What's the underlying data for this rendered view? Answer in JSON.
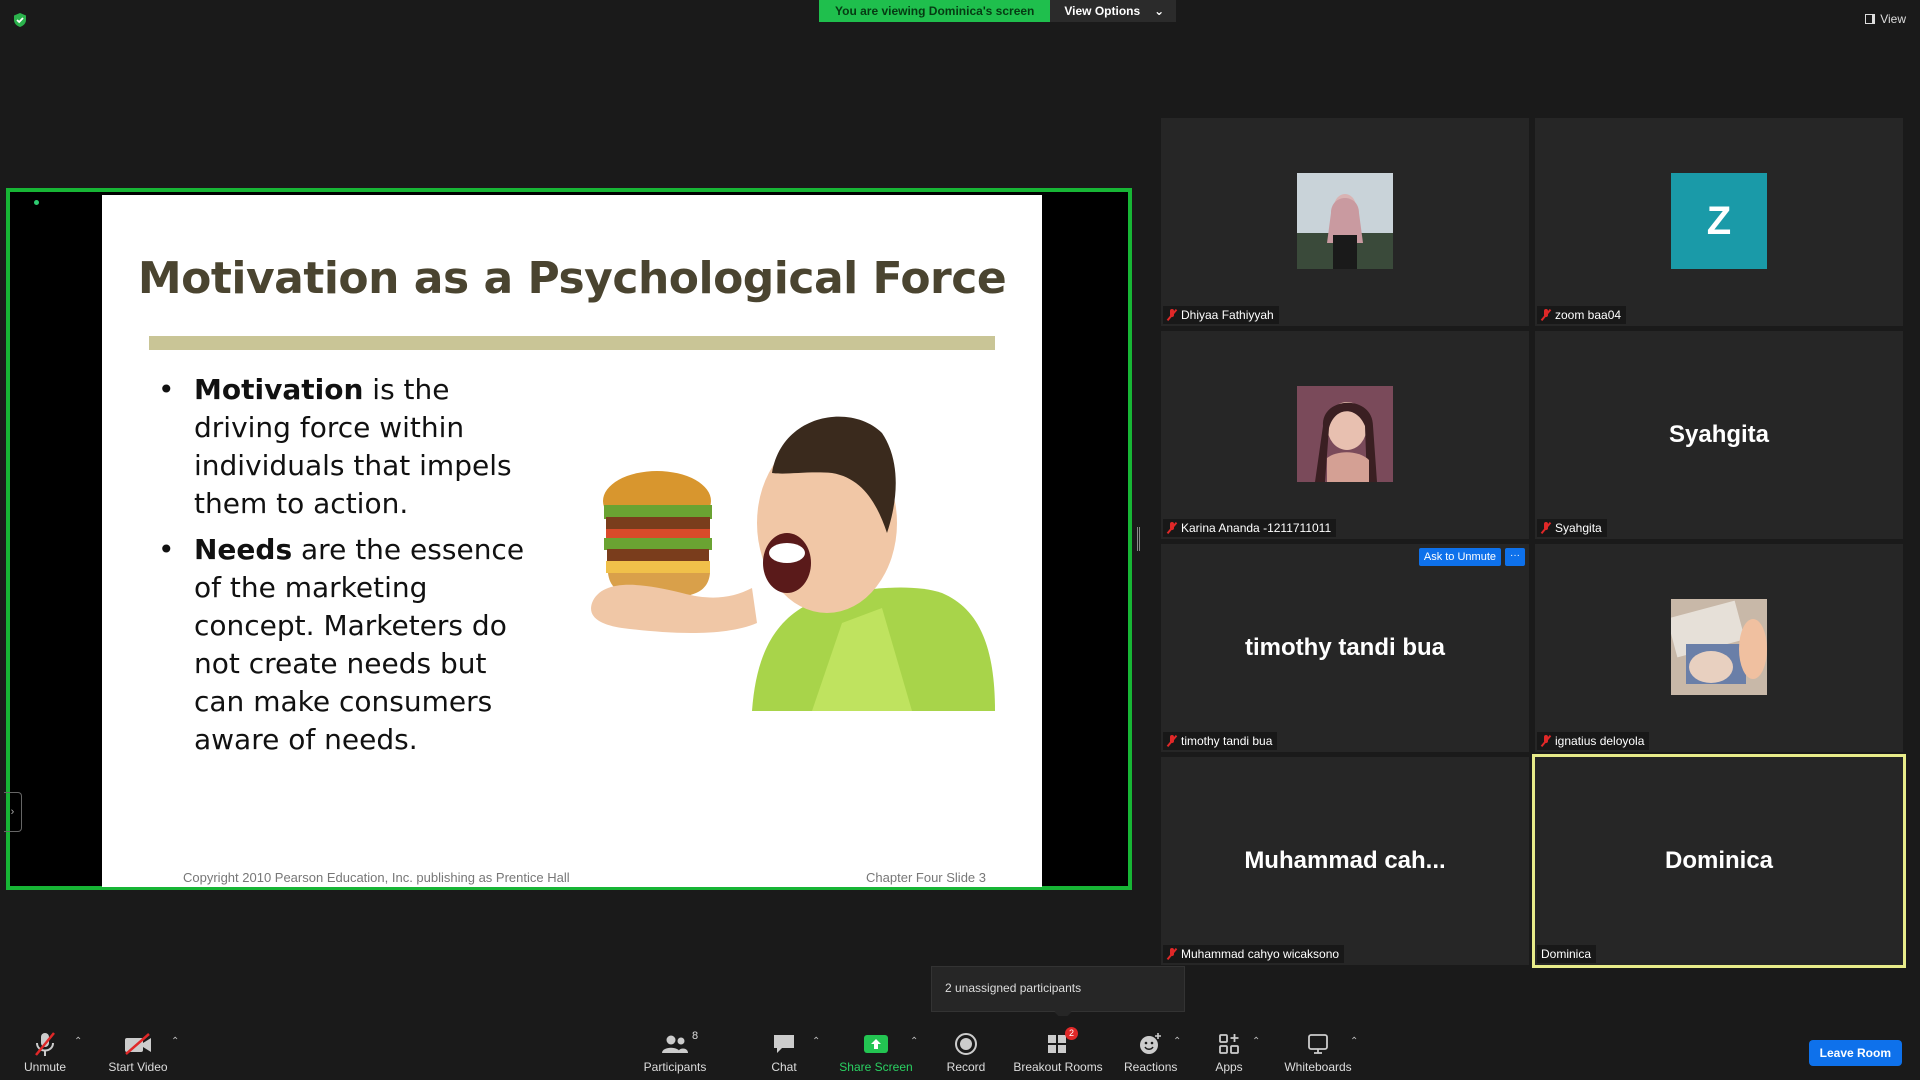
{
  "banner": {
    "viewing_text": "You are viewing Dominica's screen",
    "view_options": "View Options"
  },
  "top_right": {
    "view_label": "View"
  },
  "slide": {
    "title": "Motivation as a Psychological Force",
    "bullets": [
      {
        "bold": "Motivation",
        "text": " is the driving force within individuals that impels them to action."
      },
      {
        "bold": "Needs",
        "text": " are the essence of the marketing concept.  Marketers do not create needs but can make consumers aware of needs."
      }
    ],
    "footer_left": "Copyright 2010 Pearson Education, Inc. publishing as Prentice Hall",
    "footer_right": "Chapter Four Slide   3"
  },
  "gallery": {
    "tiles": [
      {
        "name": "Dhiyaa Fathiyyah",
        "muted": true,
        "display": "photo"
      },
      {
        "name": "zoom baa04",
        "muted": true,
        "display": "letter",
        "letter": "Z"
      },
      {
        "name": "Karina Ananda -1211711011",
        "muted": true,
        "display": "photo"
      },
      {
        "name": "Syahgita",
        "muted": true,
        "display": "text",
        "big_name": "Syahgita"
      },
      {
        "name": "timothy tandi bua",
        "muted": true,
        "display": "text",
        "big_name": "timothy tandi bua"
      },
      {
        "name": "ignatius deloyola",
        "muted": true,
        "display": "photo"
      },
      {
        "name": "Muhammad cahyo wicaksono",
        "muted": true,
        "display": "text",
        "big_name": "Muhammad  cah..."
      },
      {
        "name": "Dominica",
        "muted": false,
        "display": "text",
        "big_name": "Dominica",
        "active": true
      }
    ],
    "ask_to_unmute": "Ask to Unmute",
    "more": "···"
  },
  "tooltip": {
    "text": "2 unassigned participants"
  },
  "toolbar": {
    "unmute": "Unmute",
    "start_video": "Start Video",
    "participants": "Participants",
    "participants_count": "8",
    "chat": "Chat",
    "share_screen": "Share Screen",
    "record": "Record",
    "breakout_rooms": "Breakout Rooms",
    "breakout_badge": "2",
    "reactions": "Reactions",
    "apps": "Apps",
    "whiteboards": "Whiteboards",
    "leave_room": "Leave Room"
  },
  "colors": {
    "share_border": "#17b535",
    "accent_blue": "#0e71eb",
    "active_speaker": "#e8ec8a",
    "slide_title": "#4a4430",
    "slide_bar": "#c9c596"
  }
}
